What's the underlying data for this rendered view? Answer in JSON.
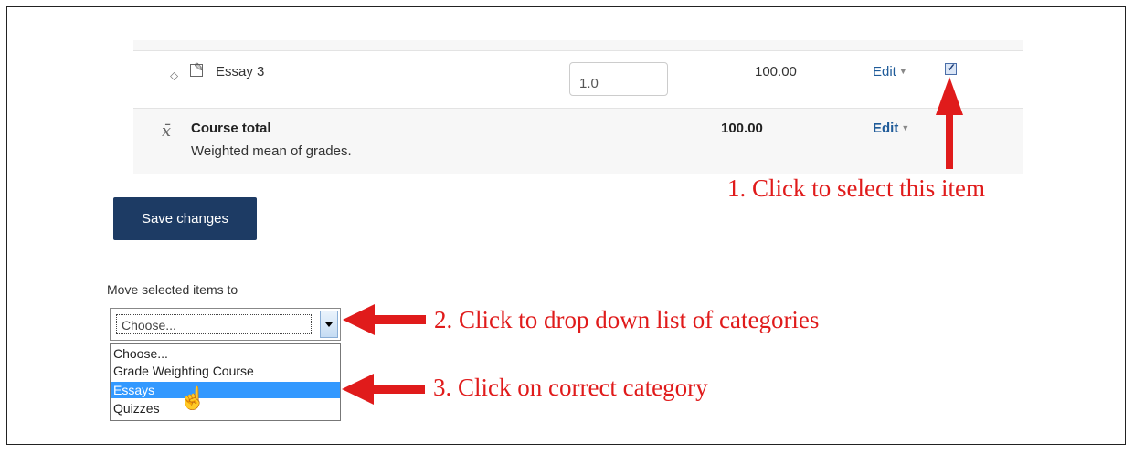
{
  "grade_table": {
    "item": {
      "name": "Essay 3",
      "weight": "1.0",
      "max_grade": "100.00",
      "edit_label": "Edit"
    },
    "course_total": {
      "name": "Course total",
      "description": "Weighted mean of grades.",
      "grade": "100.00",
      "edit_label": "Edit"
    }
  },
  "save_button_label": "Save changes",
  "move_section": {
    "label": "Move selected items to",
    "selected_value": "Choose...",
    "options": [
      "Choose...",
      "Grade Weighting Course",
      "Essays",
      "Quizzes"
    ],
    "highlighted_option": "Essays"
  },
  "annotations": {
    "step1": "1. Click to select this item",
    "step2": "2. Click to drop down list of categories",
    "step3": "3. Click on correct category",
    "color": "#e01b1b"
  },
  "colors": {
    "button_bg": "#1d3b64",
    "link": "#1f5b99",
    "option_highlight": "#3399ff"
  },
  "icons": [
    "move-icon",
    "edit-icon",
    "mean-x-bar-icon",
    "hand-cursor-icon",
    "arrow-icon"
  ]
}
